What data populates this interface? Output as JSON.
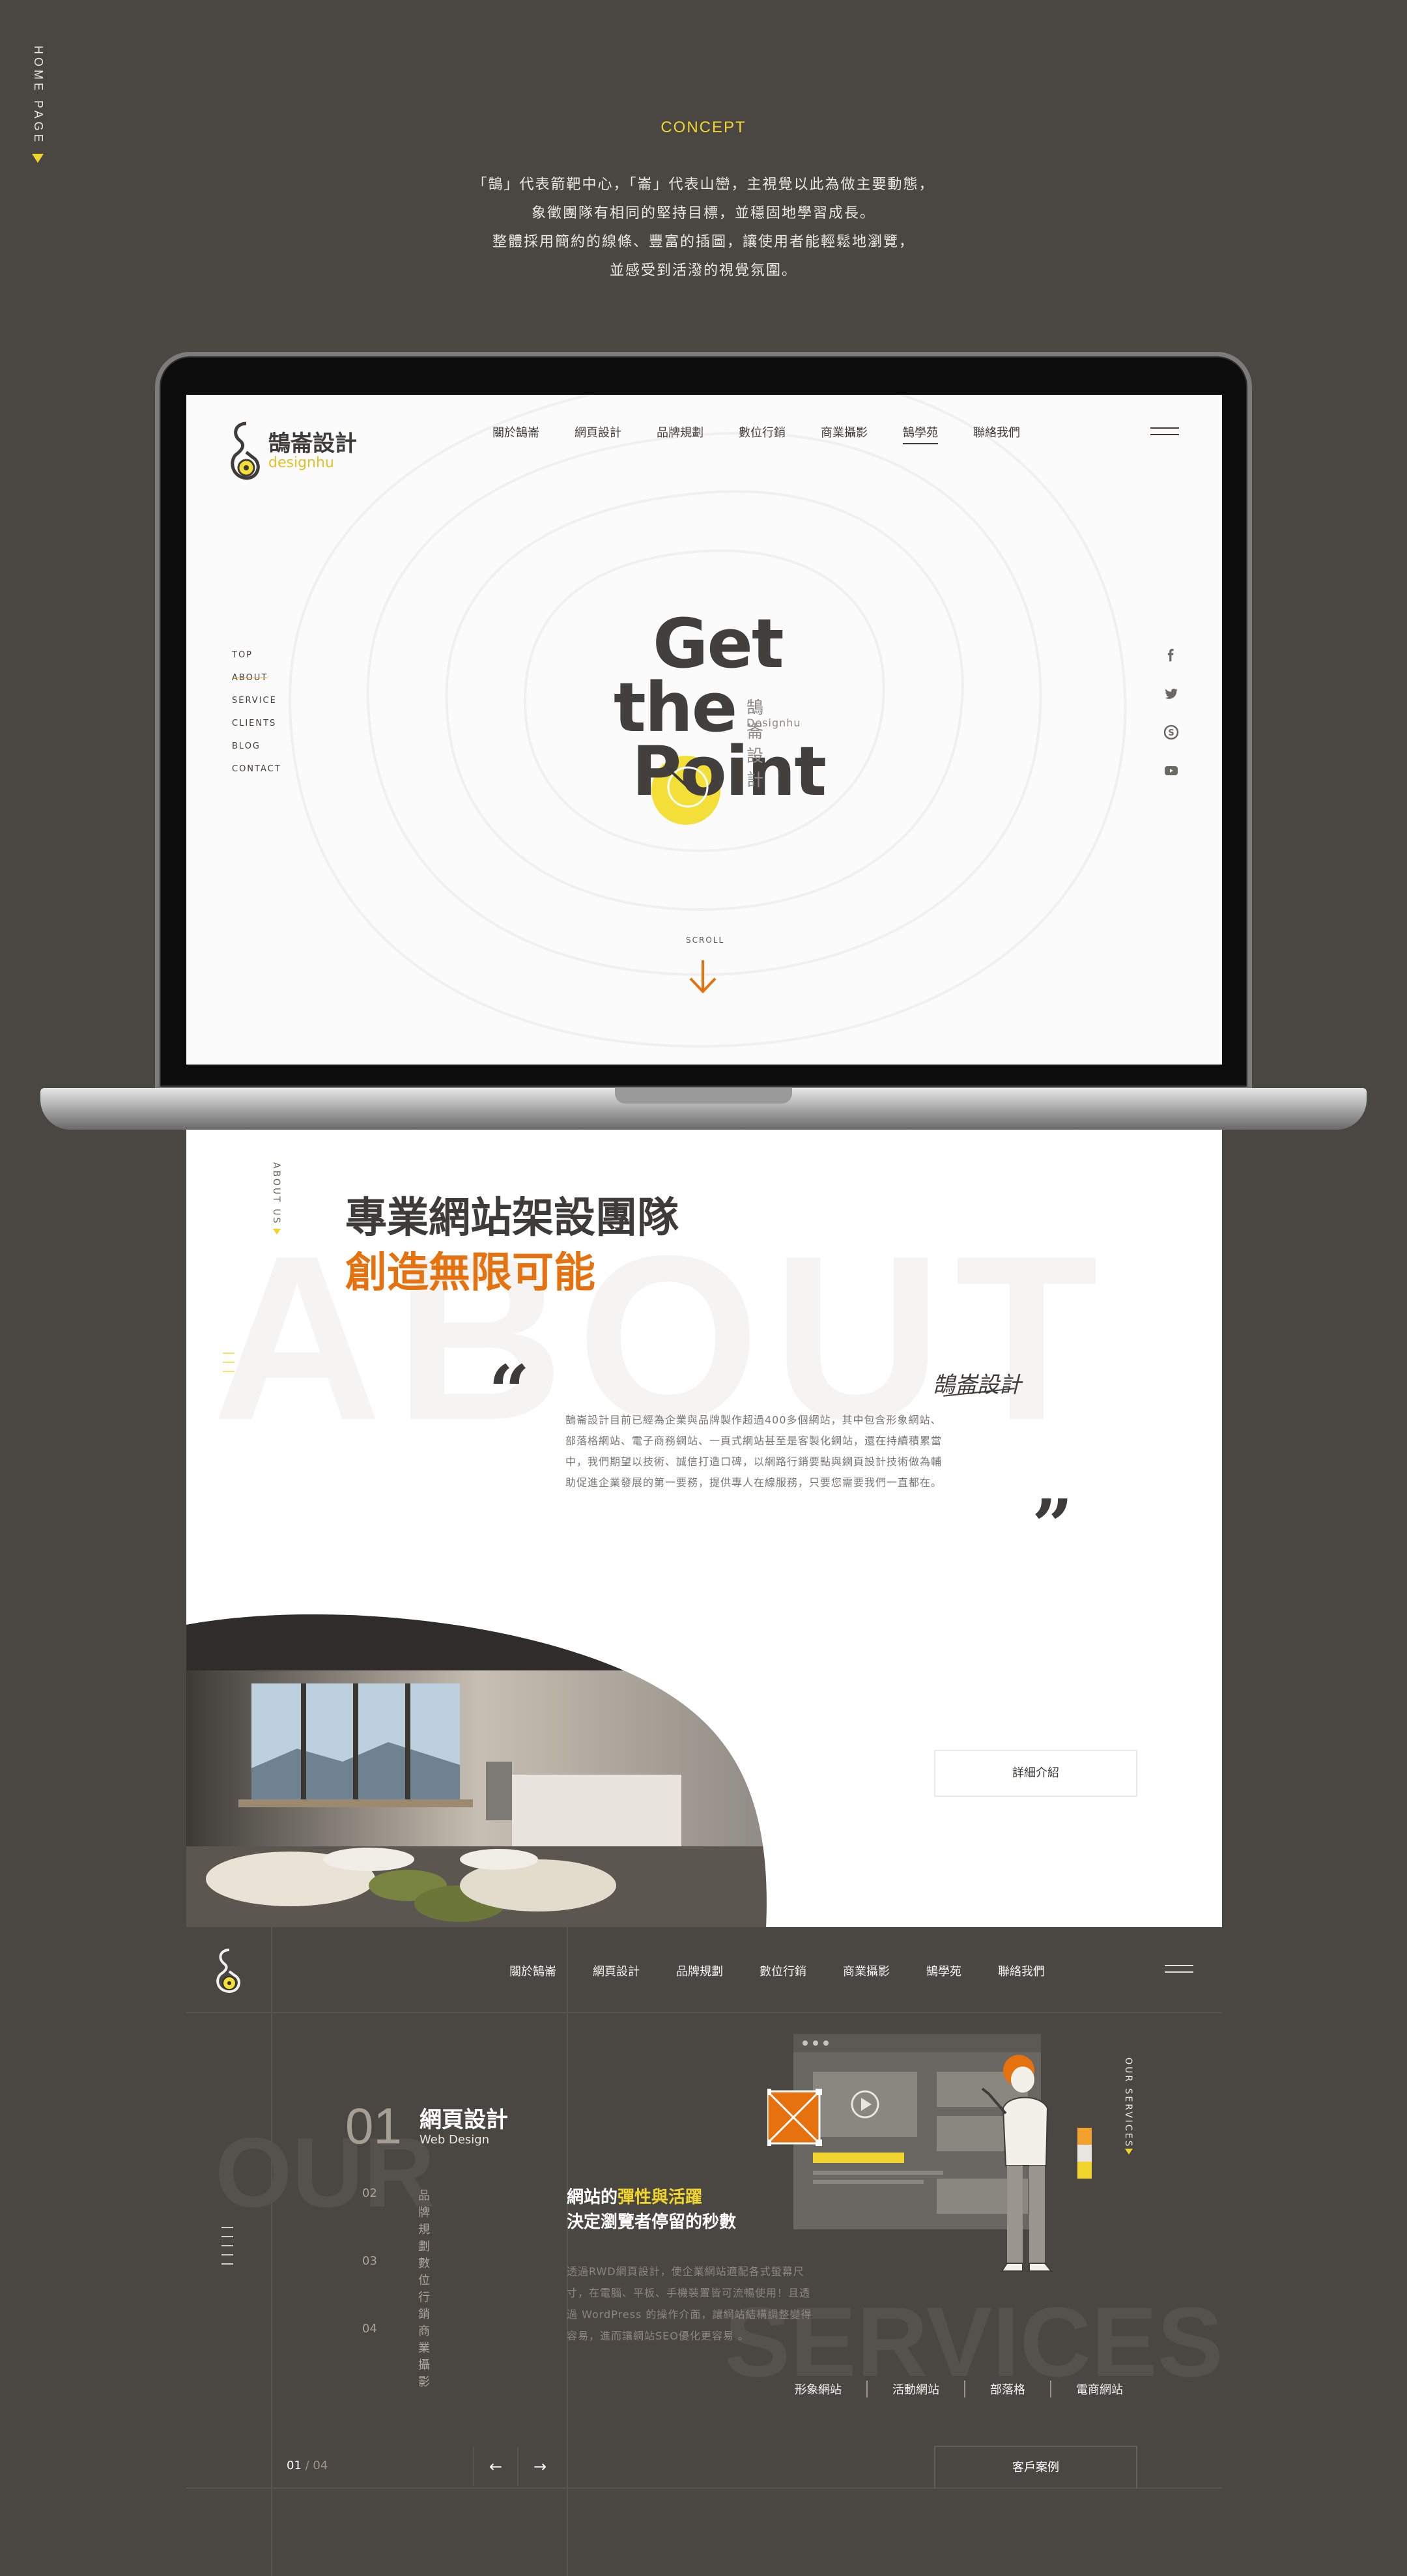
{
  "side_label": "HOME PAGE",
  "concept": {
    "title": "CONCEPT",
    "lines": [
      "「鵠」代表箭靶中心，「崙」代表山巒，主視覺以此為做主要動態，",
      "象徵團隊有相同的堅持目標，並穩固地學習成長。",
      "整體採用簡約的線條、豐富的插圖，讓使用者能輕鬆地瀏覽，",
      "並感受到活潑的視覺氛圍。"
    ]
  },
  "site": {
    "logo_cn": "鵠崙設計",
    "logo_en": "designhu",
    "nav": [
      "關於鵠崙",
      "網頁設計",
      "品牌規劃",
      "數位行銷",
      "商業攝影",
      "鵠學苑",
      "聯絡我們"
    ],
    "nav_active_index": 5,
    "anchors": [
      "TOP",
      "ABOUT",
      "SERVICE",
      "CLIENTS",
      "BLOG",
      "CONTACT"
    ],
    "anchor_active_index": 1,
    "social": [
      "facebook-icon",
      "twitter-icon",
      "skype-icon",
      "youtube-icon"
    ],
    "hero": {
      "line1": "Get",
      "line2": "the",
      "line3": "Point",
      "brand_cn": "鵠崙設計",
      "brand_en": "Designhu",
      "accent": "#f4de38"
    },
    "scroll_label": "SCROLL",
    "scroll_arrow_color": "#e6710f"
  },
  "about": {
    "side_label": "ABOUT US",
    "bg_word": "ABOUT",
    "heading": "專業網站架設團隊",
    "heading_accent": "創造無限可能",
    "accent_color": "#e6710f",
    "signature": "鵠崙設計",
    "quote_open": "“",
    "quote_close": "”",
    "paragraph": [
      "鵠崙設計目前已經為企業與品牌製作超過400多個網站，其中包含形象網站、",
      "部落格網站、電子商務網站、一頁式網站甚至是客製化網站，還在持續積累當",
      "中，我們期望以技術、誠信打造口碑，以網路行銷要點與網頁設計技術做為輔",
      "助促進企業發展的第一要務，提供專人在線服務，只要您需要我們一直都在。"
    ],
    "detail_button": "詳細介紹"
  },
  "services": {
    "nav": [
      "關於鵠崙",
      "網頁設計",
      "品牌規劃",
      "數位行銷",
      "商業攝影",
      "鵠學苑",
      "聯絡我們"
    ],
    "bg_word_1": "OUR",
    "bg_word_2": "SERVICES",
    "side_label": "OUR SERVICES",
    "active": {
      "num": "01",
      "title": "網頁設計",
      "subtitle": "Web Design"
    },
    "items": [
      {
        "num": "02",
        "title": "品牌規劃"
      },
      {
        "num": "03",
        "title": "數位行銷"
      },
      {
        "num": "04",
        "title": "商業攝影"
      }
    ],
    "headline_pre": "網站的",
    "headline_highlight": "彈性與活躍",
    "headline_line2": "決定瀏覽者停留的秒數",
    "paragraph": [
      "透過RWD網頁設計，使企業網站適配各式螢幕尺",
      "寸，在電腦、平板、手機裝置皆可流暢使用！且透",
      "過 WordPress 的操作介面，讓網站結構調整變得",
      "容易，進而讓網站SEO優化更容易 。"
    ],
    "tags": [
      "形象網站",
      "活動網站",
      "部落格",
      "電商網站"
    ],
    "pager_current": "01",
    "pager_total": "/ 04",
    "prev_label": "←",
    "next_label": "→",
    "case_button": "客戶案例"
  }
}
